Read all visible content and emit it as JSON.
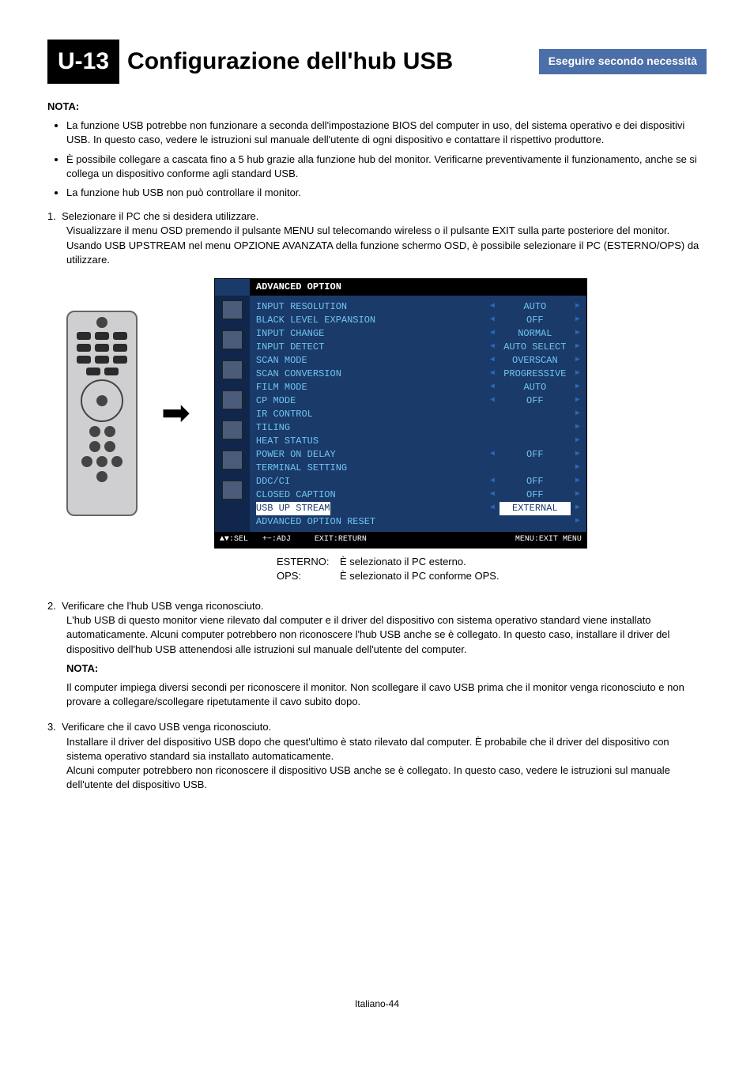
{
  "header": {
    "section_num": "U-13",
    "title": "Configurazione dell'hub USB",
    "tag": "Eseguire secondo necessità"
  },
  "nota_label": "NOTA:",
  "notes": [
    "La funzione USB potrebbe non funzionare a seconda dell'impostazione BIOS del computer in uso, del sistema operativo e dei dispositivi USB. In questo caso, vedere le istruzioni sul manuale dell'utente di ogni dispositivo e contattare il rispettivo produttore.",
    "È possibile collegare a cascata fino a 5 hub grazie alla funzione hub del monitor. Verificarne preventivamente il funzionamento, anche se si collega un dispositivo conforme agli standard USB.",
    "La funzione hub USB non può controllare il monitor."
  ],
  "step1": {
    "num": "1.",
    "head": "Selezionare il PC che si desidera utilizzare.",
    "p1": "Visualizzare il menu OSD premendo il pulsante MENU sul telecomando wireless o il pulsante EXIT sulla parte posteriore del monitor.",
    "p2": "Usando USB UPSTREAM nel menu OPZIONE AVANZATA della funzione schermo OSD, è possibile selezionare il PC (ESTERNO/OPS) da utilizzare."
  },
  "osd": {
    "title": "ADVANCED OPTION",
    "rows": [
      {
        "label": "INPUT RESOLUTION",
        "left": true,
        "right": true,
        "value": "AUTO"
      },
      {
        "label": "BLACK LEVEL EXPANSION",
        "left": true,
        "right": true,
        "value": "OFF"
      },
      {
        "label": "INPUT CHANGE",
        "left": true,
        "right": true,
        "value": "NORMAL"
      },
      {
        "label": "INPUT DETECT",
        "left": true,
        "right": true,
        "value": "AUTO SELECT"
      },
      {
        "label": "SCAN MODE",
        "left": true,
        "right": true,
        "value": "OVERSCAN"
      },
      {
        "label": "SCAN CONVERSION",
        "left": true,
        "right": true,
        "value": "PROGRESSIVE"
      },
      {
        "label": "FILM MODE",
        "left": true,
        "right": true,
        "value": "AUTO"
      },
      {
        "label": "CP MODE",
        "left": true,
        "right": true,
        "value": "OFF"
      },
      {
        "label": "IR CONTROL",
        "left": false,
        "right": true,
        "value": ""
      },
      {
        "label": "TILING",
        "left": false,
        "right": true,
        "value": ""
      },
      {
        "label": "HEAT STATUS",
        "left": false,
        "right": true,
        "value": ""
      },
      {
        "label": "POWER ON DELAY",
        "left": true,
        "right": true,
        "value": "OFF"
      },
      {
        "label": "TERMINAL SETTING",
        "left": false,
        "right": true,
        "value": ""
      },
      {
        "label": "DDC/CI",
        "left": true,
        "right": true,
        "value": "OFF"
      },
      {
        "label": "CLOSED CAPTION",
        "left": true,
        "right": true,
        "value": "OFF"
      },
      {
        "label": "USB UP STREAM",
        "left": true,
        "right": true,
        "value": "EXTERNAL",
        "hl": true
      },
      {
        "label": "ADVANCED OPTION RESET",
        "left": false,
        "right": true,
        "value": ""
      }
    ],
    "foot_left": "▲▼:SEL   +−:ADJ     EXIT:RETURN",
    "foot_right": "MENU:EXIT MENU"
  },
  "kv": [
    {
      "k": "ESTERNO:",
      "v": "È selezionato il PC esterno."
    },
    {
      "k": "OPS:",
      "v": "È selezionato il PC conforme OPS."
    }
  ],
  "step2": {
    "num": "2.",
    "head": "Verificare che l'hub USB venga riconosciuto.",
    "p1": "L'hub USB di questo monitor viene rilevato dal computer e il driver del dispositivo con sistema operativo standard viene installato automaticamente. Alcuni computer potrebbero non riconoscere l'hub USB anche se è collegato. In questo caso, installare il driver del dispositivo dell'hub USB attenendosi alle istruzioni sul manuale dell'utente del computer.",
    "nota": "NOTA:",
    "p2": "Il computer impiega diversi secondi per riconoscere il monitor. Non scollegare il cavo USB prima che il monitor venga riconosciuto e non provare a collegare/scollegare ripetutamente il cavo subito dopo."
  },
  "step3": {
    "num": "3.",
    "head": "Verificare che il cavo USB venga riconosciuto.",
    "p1": "Installare il driver del dispositivo USB dopo che quest'ultimo è stato rilevato dal computer. È probabile che il driver del dispositivo con sistema operativo standard sia installato automaticamente.",
    "p2": "Alcuni computer potrebbero non riconoscere il dispositivo USB anche se è collegato. In questo caso, vedere le istruzioni sul manuale dell'utente del dispositivo USB."
  },
  "footer": "Italiano-44"
}
